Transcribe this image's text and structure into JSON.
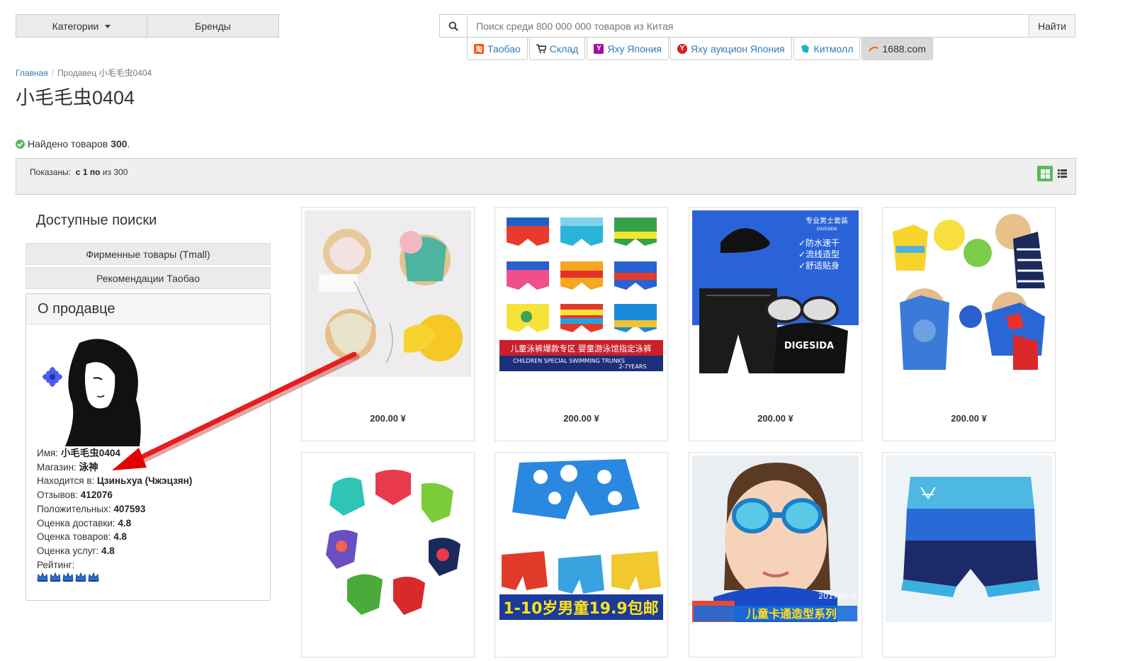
{
  "header": {
    "categories_label": "Категории",
    "brands_label": "Бренды",
    "search_placeholder": "Поиск среди 800 000 000 товаров из Китая",
    "search_button": "Найти",
    "providers": [
      {
        "label": "Таобао",
        "color": "#ff5000",
        "icon": "taobao-icon"
      },
      {
        "label": "Склад",
        "color": "#222222",
        "icon": "cart-icon"
      },
      {
        "label": "Яху Япония",
        "color": "#a30ea0",
        "icon": "yahoo-icon"
      },
      {
        "label": "Яху аукцион Япония",
        "color": "#d81e1e",
        "icon": "yahoo-auction-icon"
      },
      {
        "label": "Китмолл",
        "color": "#1ab3c9",
        "icon": "kitmall-icon"
      },
      {
        "label": "1688.com",
        "color": "#ff6a00",
        "icon": "1688-icon"
      }
    ]
  },
  "breadcrumb": {
    "home": "Главная",
    "current": "Продавец 小毛毛虫0404"
  },
  "page_title": "小毛毛虫0404",
  "found": {
    "text": "Найдено товаров",
    "count": "300",
    "suffix": "."
  },
  "pagination": {
    "shown_label": "Показаны:",
    "range_prefix": "с",
    "from": "1",
    "to_label": "по",
    "of_label": "из",
    "total": "300"
  },
  "sidebar": {
    "heading": "Доступные поиски",
    "links": [
      "Фирменные товары (Tmall)",
      "Рекомендации Таобао"
    ],
    "seller_panel_title": "О продавце",
    "seller": {
      "name_label": "Имя:",
      "name": "小毛毛虫0404",
      "shop_label": "Магазин:",
      "shop": "泳神",
      "location_label": "Находится в:",
      "location": "Цзиньхуа (Чжэцзян)",
      "reviews_label": "Отзывов:",
      "reviews": "412076",
      "positive_label": "Положительных:",
      "positive": "407593",
      "delivery_label": "Оценка доставки:",
      "delivery": "4.8",
      "goods_label": "Оценка товаров:",
      "goods": "4.8",
      "service_label": "Оценка услуг:",
      "service": "4.8",
      "rating_label": "Рейтинг:",
      "rating_icons": 5
    }
  },
  "products": [
    {
      "price": "200.00 ¥",
      "image": "baby-swim-hats-set"
    },
    {
      "price": "200.00 ¥",
      "image": "kids-swim-trunks-grid",
      "banner": "儿童泳裤爆款专区 婴童游泳馆指定泳裤",
      "banner_sub": "CHILDREN SPECIAL SWIMMING TRUNKS",
      "banner_years": "2-7YEARS"
    },
    {
      "price": "200.00 ¥",
      "image": "mens-swim-set",
      "lines": [
        "专业男士套装",
        "DIGESIDA",
        "✓防水速干",
        "✓流线造型",
        "✓舒适贴身"
      ],
      "brand": "DIGESIDA"
    },
    {
      "price": "200.00 ¥",
      "image": "kids-swimsuits-frog-superman"
    },
    {
      "price": "",
      "image": "toddler-swim-briefs-circle"
    },
    {
      "price": "",
      "image": "boys-swim-trunks-clouds",
      "banner": "1-10岁男童19.9包邮"
    },
    {
      "price": "",
      "image": "boy-swim-goggles",
      "caption": "儿童卡通造型系列",
      "tag": "2017NEW"
    },
    {
      "price": "",
      "image": "blue-swim-shorts"
    }
  ]
}
